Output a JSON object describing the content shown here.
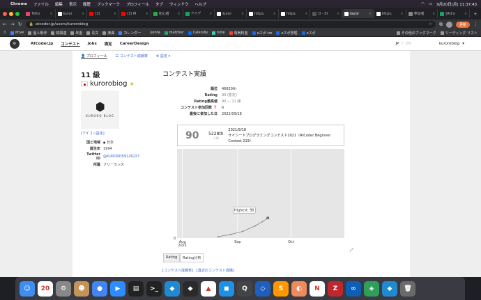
{
  "menubar": {
    "app": "Chrome",
    "items": [
      "ファイル",
      "編集",
      "表示",
      "履歴",
      "ブックマーク",
      "プロフィール",
      "タブ",
      "ウィンドウ",
      "ヘルプ"
    ],
    "datetime": "9月20日(月) 11:37:43"
  },
  "tabs": [
    {
      "label": "Tikto",
      "color": "#e8466b"
    },
    {
      "label": "kuror",
      "color": "#ffffff"
    },
    {
      "label": "(3)",
      "color": "#ff0000"
    },
    {
      "label": "(3) M",
      "color": "#ff0000"
    },
    {
      "label": "初心者",
      "color": "#2ba84a"
    },
    {
      "label": "アイデ",
      "color": "#1aa260"
    },
    {
      "label": "kuror",
      "color": "#ffffff"
    },
    {
      "label": "https:",
      "color": "#ffffff"
    },
    {
      "label": "https:",
      "color": "#ffffff"
    },
    {
      "label": "D - St",
      "color": "#555555"
    },
    {
      "label": "kuror",
      "color": "#ffffff",
      "active": true
    },
    {
      "label": "https:",
      "color": "#ffffff"
    },
    {
      "label": "参加者",
      "color": "#888888"
    },
    {
      "label": "[AtCo",
      "color": "#1aa260"
    }
  ],
  "address": {
    "url": "atcoder.jp/users/kurorobiog",
    "update_label": "更新"
  },
  "bookmarks": [
    {
      "label": "drive",
      "color": "#4285f4"
    },
    {
      "label": "個人制作",
      "color": "#999999"
    },
    {
      "label": "株関連",
      "color": "#999999"
    },
    {
      "label": "年金",
      "color": "#999999"
    },
    {
      "label": "青文",
      "color": "#999999"
    },
    {
      "label": "楽曲",
      "color": "#999999"
    },
    {
      "label": "カレンダー",
      "color": "#4285f4"
    },
    {
      "label": "yenta",
      "color": "#333333"
    },
    {
      "label": "matcher",
      "color": "#22aa66"
    },
    {
      "label": "Calendly",
      "color": "#006bff"
    },
    {
      "label": "note",
      "color": "#41c9b4"
    },
    {
      "label": "電気料金",
      "color": "#ee4433"
    },
    {
      "label": "eスポ-tre",
      "color": "#2266dd"
    },
    {
      "label": "eスポ管理",
      "color": "#2266dd"
    },
    {
      "label": "eスポ",
      "color": "#2266dd"
    },
    {
      "label": "その他のブックマーク",
      "color": "#999999"
    },
    {
      "label": "リーディング リスト",
      "color": "#999999"
    }
  ],
  "nav": {
    "site": "AtCoder.jp",
    "links": [
      "コンテスト",
      "Jobs",
      "検定",
      "CareerDesign"
    ],
    "lang_jp": "JP",
    "lang_en": "EN",
    "user": "kurorobiog"
  },
  "subnav": [
    "プロフィール",
    "コンテスト成績表",
    "設定"
  ],
  "profile": {
    "rank": "11 級",
    "username": "kurorobiog",
    "avatar_text": "KURORO BLOG",
    "icon_setting": "[アイコン設定]",
    "rows": [
      {
        "k": "国と地域",
        "v": "日本"
      },
      {
        "k": "誕生年",
        "v": "1994"
      },
      {
        "k": "Twitter ID",
        "v": "@KURORO59126227"
      },
      {
        "k": "所属",
        "v": "フリーランス"
      }
    ]
  },
  "main": {
    "heading": "コンテスト実績",
    "stats": [
      {
        "k": "順位",
        "v": "46829th"
      },
      {
        "k": "Rating",
        "v": "90 (暫定)"
      },
      {
        "k": "Rating最高値",
        "v": "90 — 11 級"
      },
      {
        "k": "コンテスト参加回数",
        "v": "6"
      },
      {
        "k": "最後に参加した日",
        "v": "2021/09/18"
      }
    ],
    "card": {
      "rating": "90",
      "place": "5228th",
      "delta": "+16",
      "date": "2021/9/18",
      "contest": "サイシードプログラミングコンテスト2021（AtCoder Beginner Contest 219）"
    },
    "chart_tabs": [
      "Rating",
      "Rating分布"
    ],
    "links": [
      "[コンテスト成績表]",
      "[直近のコンテスト成績]"
    ]
  },
  "chart_data": {
    "type": "line",
    "title": "",
    "xlabel": "",
    "ylabel": "",
    "x_ticks": [
      "Aug 2021",
      "Sep",
      "Oct"
    ],
    "y_ticks": [
      "0"
    ],
    "ylim": [
      0,
      400
    ],
    "series": [
      {
        "values": [
          {
            "x": "2021-08-21",
            "y": 6
          },
          {
            "x": "2021-08-28",
            "y": 16
          },
          {
            "x": "2021-09-04",
            "y": 30
          },
          {
            "x": "2021-09-11",
            "y": 55
          },
          {
            "x": "2021-09-15",
            "y": 74
          },
          {
            "x": "2021-09-18",
            "y": 90
          }
        ]
      }
    ],
    "annotation": "Highest: 90",
    "colors": {
      "bg": "#e6e6e6",
      "line": "#808080"
    }
  },
  "dock": [
    {
      "name": "finder",
      "color": "#3d8ef0",
      "glyph": "☺"
    },
    {
      "name": "calendar",
      "color": "#ffffff",
      "glyph": "20"
    },
    {
      "name": "settings",
      "color": "#888888",
      "glyph": "⚙"
    },
    {
      "name": "contacts",
      "color": "#c4935a",
      "glyph": "☻"
    },
    {
      "name": "chrome",
      "color": "#4285f4",
      "glyph": "●"
    },
    {
      "name": "zoom",
      "color": "#2d8cff",
      "glyph": "▶"
    },
    {
      "name": "activity",
      "color": "#222222",
      "glyph": "▤"
    },
    {
      "name": "terminal",
      "color": "#222222",
      "glyph": ">_"
    },
    {
      "name": "vscode",
      "color": "#1f8ad2",
      "glyph": "◆"
    },
    {
      "name": "vscode2",
      "color": "#2a2a2a",
      "glyph": "◆"
    },
    {
      "name": "analytics",
      "color": "#ffffff",
      "glyph": "▲"
    },
    {
      "name": "docker",
      "color": "#1d91e6",
      "glyph": "◼"
    },
    {
      "name": "quicktime",
      "color": "#444444",
      "glyph": "Q"
    },
    {
      "name": "sourcetree",
      "color": "#1c5fbf",
      "glyph": "◇"
    },
    {
      "name": "sublime",
      "color": "#ff9800",
      "glyph": "S"
    },
    {
      "name": "app",
      "color": "#f08a5d",
      "glyph": "◐"
    },
    {
      "name": "notion",
      "color": "#ffffff",
      "glyph": "N"
    },
    {
      "name": "filezilla",
      "color": "#c0272d",
      "glyph": "Z"
    },
    {
      "name": "infinity",
      "color": "#0b5fb4",
      "glyph": "∞"
    },
    {
      "name": "app2",
      "color": "#2f9e5a",
      "glyph": "◈"
    },
    {
      "name": "vscode3",
      "color": "#1f8ad2",
      "glyph": "◆"
    },
    {
      "name": "trash",
      "color": "#6a6a6a",
      "glyph": "🗑"
    }
  ]
}
